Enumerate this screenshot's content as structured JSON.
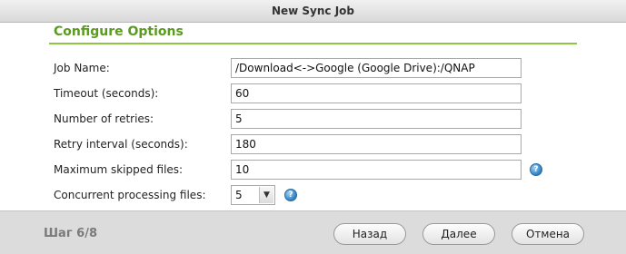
{
  "window": {
    "title": "New Sync Job"
  },
  "section": {
    "title": "Configure Options"
  },
  "fields": {
    "job_name": {
      "label": "Job Name:",
      "value": "/Download<->Google (Google Drive):/QNAP"
    },
    "timeout": {
      "label": "Timeout (seconds):",
      "value": "60"
    },
    "retries": {
      "label": "Number of retries:",
      "value": "5"
    },
    "retry_interval": {
      "label": "Retry interval (seconds):",
      "value": "180"
    },
    "max_skipped": {
      "label": "Maximum skipped files:",
      "value": "10"
    },
    "concurrent": {
      "label": "Concurrent processing files:",
      "value": "5"
    }
  },
  "icons": {
    "help": "help-icon",
    "dropdown": "chevron-down-icon"
  },
  "footer": {
    "step": "Шаг 6/8",
    "back_label": "Назад",
    "next_label": "Далее",
    "cancel_label": "Отмена"
  },
  "colors": {
    "accent_green": "#5a9a1e",
    "rule_green": "#8cc63f",
    "help_blue": "#2d7fc1"
  }
}
